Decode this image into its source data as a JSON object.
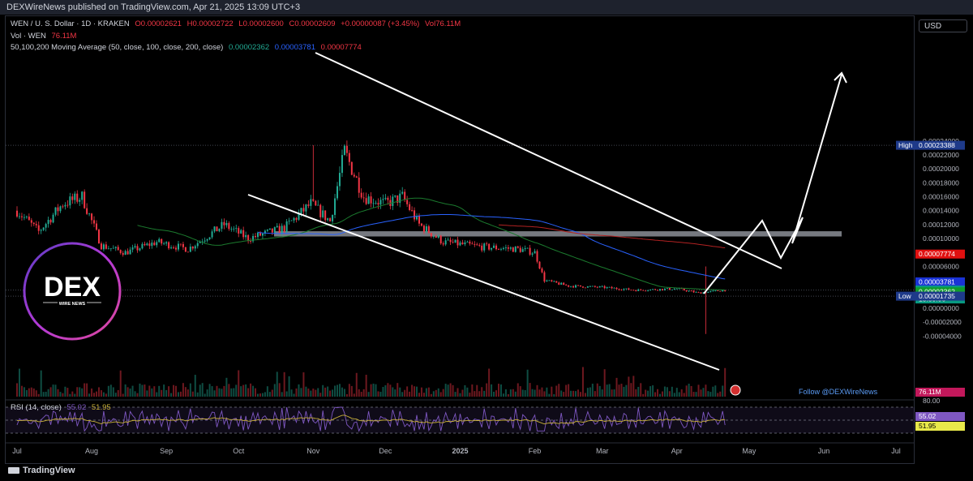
{
  "header": {
    "publish_line": "DEXWireNews published on TradingView.com, Apr 21, 2025 13:09 UTC+3",
    "symbol": "WEN / U. S. Dollar · 1D · KRAKEN",
    "ohlc": {
      "o": "O0.00002621",
      "h": "H0.00002722",
      "l": "L0.00002600",
      "c": "C0.00002609",
      "chg": "+0.00000087 (+3.45%)",
      "vol": "Vol76.11M"
    },
    "vol_line": {
      "label": "Vol · WEN",
      "value": "76.11M"
    },
    "ma_line": {
      "label": "50,100,200 Moving Average (50, close, 100, close, 200, close)",
      "ma50": "0.00002362",
      "ma100": "0.00003781",
      "ma200": "0.00007774"
    },
    "currency": "USD",
    "rsi_label": {
      "label": "RSI (14, close)",
      "v1": "55.02",
      "v2": "51.95"
    }
  },
  "footer": {
    "brand": "TradingView",
    "follow": "Follow @DEXWireNews"
  },
  "logo": {
    "title": "DEX",
    "subtitle": "WIRE NEWS"
  },
  "colors": {
    "up": "#22ab94",
    "down": "#f23645",
    "ma50": "#1b7a2e",
    "ma100": "#2962ff",
    "ma200": "#b22222",
    "rsi": "#7e57c2",
    "rsi_ma": "#c9b037",
    "bg": "#000000"
  },
  "chart_data": {
    "type": "line",
    "title": "WEN / U. S. Dollar · 1D · KRAKEN",
    "x_ticks": [
      "Jul",
      "Aug",
      "Sep",
      "Oct",
      "Nov",
      "Dec",
      "2025",
      "Feb",
      "Mar",
      "Apr",
      "May",
      "Jun",
      "Jul"
    ],
    "y_ticks": [
      "0.00024000",
      "0.00022000",
      "0.00020000",
      "0.00018000",
      "0.00016000",
      "0.00014000",
      "0.00012000",
      "0.00010000",
      "0.00008000",
      "0.00006000",
      "0.00004000",
      "0.00002000",
      "0.00000000",
      "-0.00002000",
      "-0.00004000"
    ],
    "ylim": [
      -5e-05,
      0.00025
    ],
    "price_labels": [
      {
        "tag": "High",
        "value": "0.00023388",
        "price": 0.00023388,
        "color": "#1e3a8a"
      },
      {
        "tag": "",
        "value": "0.00007774",
        "price": 7.774e-05,
        "color": "#e01010"
      },
      {
        "tag": "",
        "value": "0.00003781",
        "price": 3.781e-05,
        "color": "#1a33d6"
      },
      {
        "tag": "",
        "value": "0.00002609",
        "price": 2.609e-05,
        "color": "#089981",
        "sub": "13:50:06"
      },
      {
        "tag": "",
        "value": "0.00002362",
        "price": 2.362e-05,
        "color": "#119c2c"
      },
      {
        "tag": "Low",
        "value": "0.00001735",
        "price": 1.735e-05,
        "color": "#1e3a8a"
      }
    ],
    "volume_label": "76.11M",
    "price_path": [
      {
        "date": "2024-07-01",
        "close": 0.00014
      },
      {
        "date": "2024-07-10",
        "close": 0.00011
      },
      {
        "date": "2024-07-20",
        "close": 0.00015
      },
      {
        "date": "2024-07-28",
        "close": 0.00016
      },
      {
        "date": "2024-08-05",
        "close": 9e-05
      },
      {
        "date": "2024-08-15",
        "close": 8e-05
      },
      {
        "date": "2024-08-28",
        "close": 9.5e-05
      },
      {
        "date": "2024-09-10",
        "close": 8.5e-05
      },
      {
        "date": "2024-09-25",
        "close": 0.00012
      },
      {
        "date": "2024-10-05",
        "close": 0.0001
      },
      {
        "date": "2024-10-20",
        "close": 0.000115
      },
      {
        "date": "2024-10-31",
        "close": 0.00015
      },
      {
        "date": "2024-11-08",
        "close": 0.000125
      },
      {
        "date": "2024-11-14",
        "close": 0.000225
      },
      {
        "date": "2024-11-22",
        "close": 0.00016
      },
      {
        "date": "2024-12-01",
        "close": 0.00015
      },
      {
        "date": "2024-12-08",
        "close": 0.00016
      },
      {
        "date": "2024-12-15",
        "close": 0.00012
      },
      {
        "date": "2024-12-25",
        "close": 9.5e-05
      },
      {
        "date": "2025-01-10",
        "close": 8.8e-05
      },
      {
        "date": "2025-01-25",
        "close": 8.5e-05
      },
      {
        "date": "2025-02-01",
        "close": 8e-05
      },
      {
        "date": "2025-02-05",
        "close": 4e-05
      },
      {
        "date": "2025-02-15",
        "close": 3.2e-05
      },
      {
        "date": "2025-03-01",
        "close": 3e-05
      },
      {
        "date": "2025-03-15",
        "close": 2.6e-05
      },
      {
        "date": "2025-04-01",
        "close": 2.8e-05
      },
      {
        "date": "2025-04-10",
        "close": 2.2e-05
      },
      {
        "date": "2025-04-21",
        "close": 2.609e-05
      }
    ],
    "rsi": {
      "levels": [
        80,
        50,
        20
      ],
      "top_label": "80.00",
      "last": 55.02,
      "ma_last": 51.95
    }
  }
}
